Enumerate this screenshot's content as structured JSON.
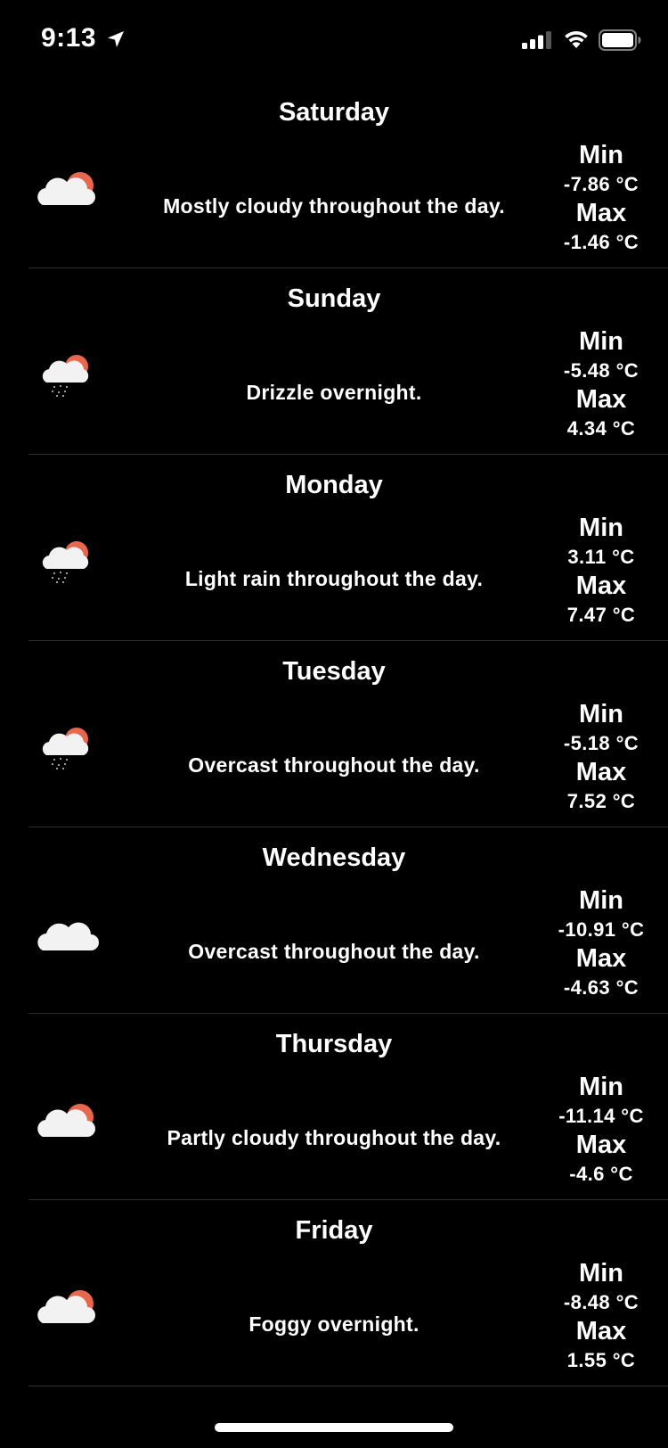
{
  "status_bar": {
    "time": "9:13"
  },
  "forecast": [
    {
      "day": "Saturday",
      "icon": "partly-cloudy-icon",
      "summary": "Mostly cloudy throughout the day.",
      "min_label": "Min",
      "min": "-7.86 °C",
      "max_label": "Max",
      "max": "-1.46 °C"
    },
    {
      "day": "Sunday",
      "icon": "rain-icon",
      "summary": "Drizzle overnight.",
      "min_label": "Min",
      "min": "-5.48 °C",
      "max_label": "Max",
      "max": "4.34 °C"
    },
    {
      "day": "Monday",
      "icon": "rain-icon",
      "summary": "Light rain throughout the day.",
      "min_label": "Min",
      "min": "3.11 °C",
      "max_label": "Max",
      "max": "7.47 °C"
    },
    {
      "day": "Tuesday",
      "icon": "rain-icon",
      "summary": "Overcast throughout the day.",
      "min_label": "Min",
      "min": "-5.18 °C",
      "max_label": "Max",
      "max": "7.52 °C"
    },
    {
      "day": "Wednesday",
      "icon": "cloud-icon",
      "summary": "Overcast throughout the day.",
      "min_label": "Min",
      "min": "-10.91 °C",
      "max_label": "Max",
      "max": "-4.63 °C"
    },
    {
      "day": "Thursday",
      "icon": "partly-cloudy-icon",
      "summary": "Partly cloudy throughout the day.",
      "min_label": "Min",
      "min": "-11.14 °C",
      "max_label": "Max",
      "max": "-4.6 °C"
    },
    {
      "day": "Friday",
      "icon": "partly-cloudy-icon",
      "summary": "Foggy overnight.",
      "min_label": "Min",
      "min": "-8.48 °C",
      "max_label": "Max",
      "max": "1.55 °C"
    }
  ],
  "colors": {
    "background": "#000000",
    "text": "#ffffff",
    "sun": "#e8684f",
    "cloud": "#f2f2f2",
    "separator": "#2e2e2e"
  }
}
